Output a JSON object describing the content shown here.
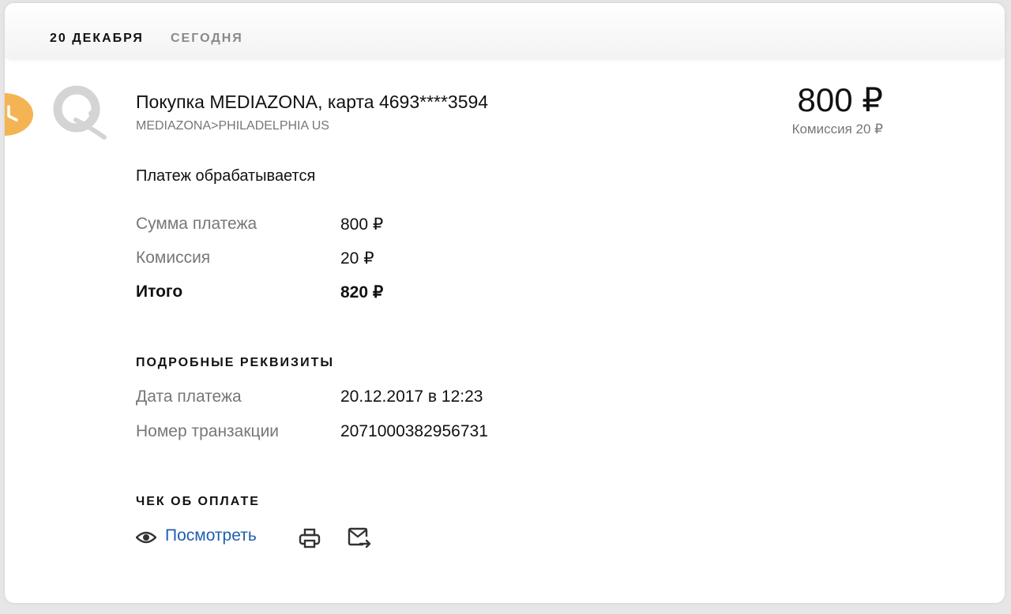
{
  "header": {
    "date": "20 ДЕКАБРЯ",
    "relative_day": "СЕГОДНЯ"
  },
  "transaction": {
    "title": "Покупка MEDIAZONA, карта 4693****3594",
    "merchant_location": "MEDIAZONA>PHILADELPHIA US",
    "amount": "800 ₽",
    "commission_summary": "Комиссия 20 ₽",
    "status": "Платеж обрабатывается"
  },
  "breakdown": [
    {
      "label": "Сумма платежа",
      "value": "800 ₽"
    },
    {
      "label": "Комиссия",
      "value": "20 ₽"
    },
    {
      "label": "Итого",
      "value": "820 ₽"
    }
  ],
  "details": {
    "heading": "ПОДРОБНЫЕ РЕКВИЗИТЫ",
    "rows": [
      {
        "label": "Дата платежа",
        "value": "20.12.2017 в 12:23"
      },
      {
        "label": "Номер транзакции",
        "value": "2071000382956731"
      }
    ]
  },
  "receipt": {
    "heading": "ЧЕК ОБ ОПЛАТЕ",
    "view_label": "Посмотреть",
    "icons": [
      "eye-icon",
      "print-icon",
      "mail-forward-icon"
    ]
  },
  "colors": {
    "status_clock": "#f5b453",
    "link": "#1f5fae",
    "muted_text": "#777777",
    "logo_gray": "#d4d4d4"
  }
}
